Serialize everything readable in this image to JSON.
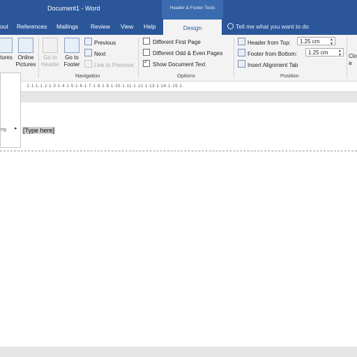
{
  "window": {
    "title": "Document1 - Word",
    "contextual_title": "Header & Footer Tools"
  },
  "tabs": [
    {
      "label": "out"
    },
    {
      "label": "References"
    },
    {
      "label": "Mailings"
    },
    {
      "label": "Review"
    },
    {
      "label": "View"
    },
    {
      "label": "Help"
    },
    {
      "label": "Design"
    }
  ],
  "tell_me": {
    "placeholder": "Tell me what you want to do"
  },
  "insert_group": {
    "pictures_label": "ctures",
    "online_pictures_line1": "Online",
    "online_pictures_line2": "Pictures"
  },
  "navigation": {
    "go_to_header_line1": "Go to",
    "go_to_header_line2": "Header",
    "go_to_footer_line1": "Go to",
    "go_to_footer_line2": "Footer",
    "previous": "Previous",
    "next": "Next",
    "link_to_previous": "Link to Previous",
    "group_label": "Navigation"
  },
  "options": {
    "different_first_page": {
      "label": "Different First Page",
      "checked": false
    },
    "different_odd_even": {
      "label": "Different Odd & Even Pages",
      "checked": false
    },
    "show_document_text": {
      "label": "Show Document Text",
      "checked": true
    },
    "group_label": "Options"
  },
  "position": {
    "header_from_top_label": "Header from Top:",
    "header_from_top_value": "1.25 cm",
    "footer_from_bottom_label": "Footer from Bottom:",
    "footer_from_bottom_value": "1.25 cm",
    "insert_alignment_tab": "Insert Alignment Tab",
    "group_label": "Position"
  },
  "close": {
    "line1": "Clo",
    "line2": "a"
  },
  "ruler": {
    "marks": "·1·1·1·1·2·1·3·1·4·1·5·1·6·1·7·1·8·1·9·1·10·1·11·1·12·1·13·1·14·1·15·1·"
  },
  "document": {
    "header_placeholder": "[Type here]"
  },
  "left_menu": {
    "item_label": "rty"
  }
}
